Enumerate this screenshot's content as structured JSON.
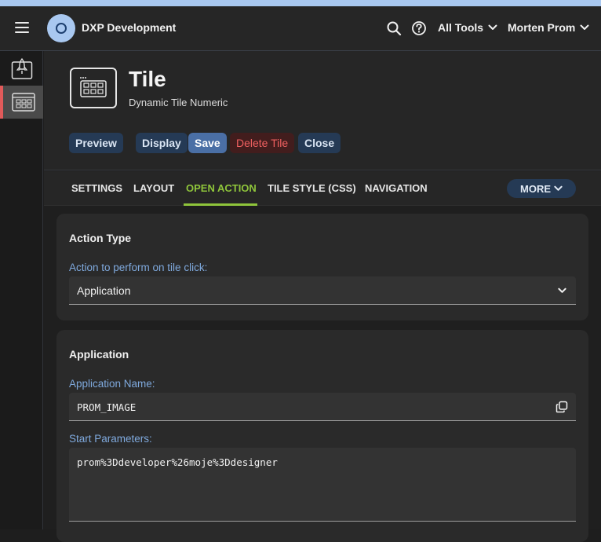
{
  "topbar": {
    "app_title": "DXP Development",
    "tools_label": "All Tools",
    "user_label": "Morten Prom"
  },
  "header": {
    "title": "Tile",
    "subtitle": "Dynamic Tile Numeric"
  },
  "actions": {
    "preview": "Preview",
    "display": "Display",
    "save": "Save",
    "delete": "Delete Tile",
    "close": "Close"
  },
  "tabs": {
    "items": [
      "SETTINGS",
      "LAYOUT",
      "OPEN ACTION",
      "TILE STYLE (CSS)",
      "NAVIGATION"
    ],
    "active": "OPEN ACTION",
    "more": "MORE"
  },
  "action_type": {
    "title": "Action Type",
    "label": "Action to perform on tile click:",
    "value": "Application"
  },
  "application": {
    "title": "Application",
    "name_label": "Application Name:",
    "name_value": "PROM_IMAGE",
    "params_label": "Start Parameters:",
    "params_value": "prom%3Ddeveloper%26moje%3Ddesigner"
  },
  "colors": {
    "accent_green": "#8fc53b",
    "button_blue": "#4a6fa5",
    "danger_red": "#f06060",
    "label_blue": "#7fa9dd"
  }
}
